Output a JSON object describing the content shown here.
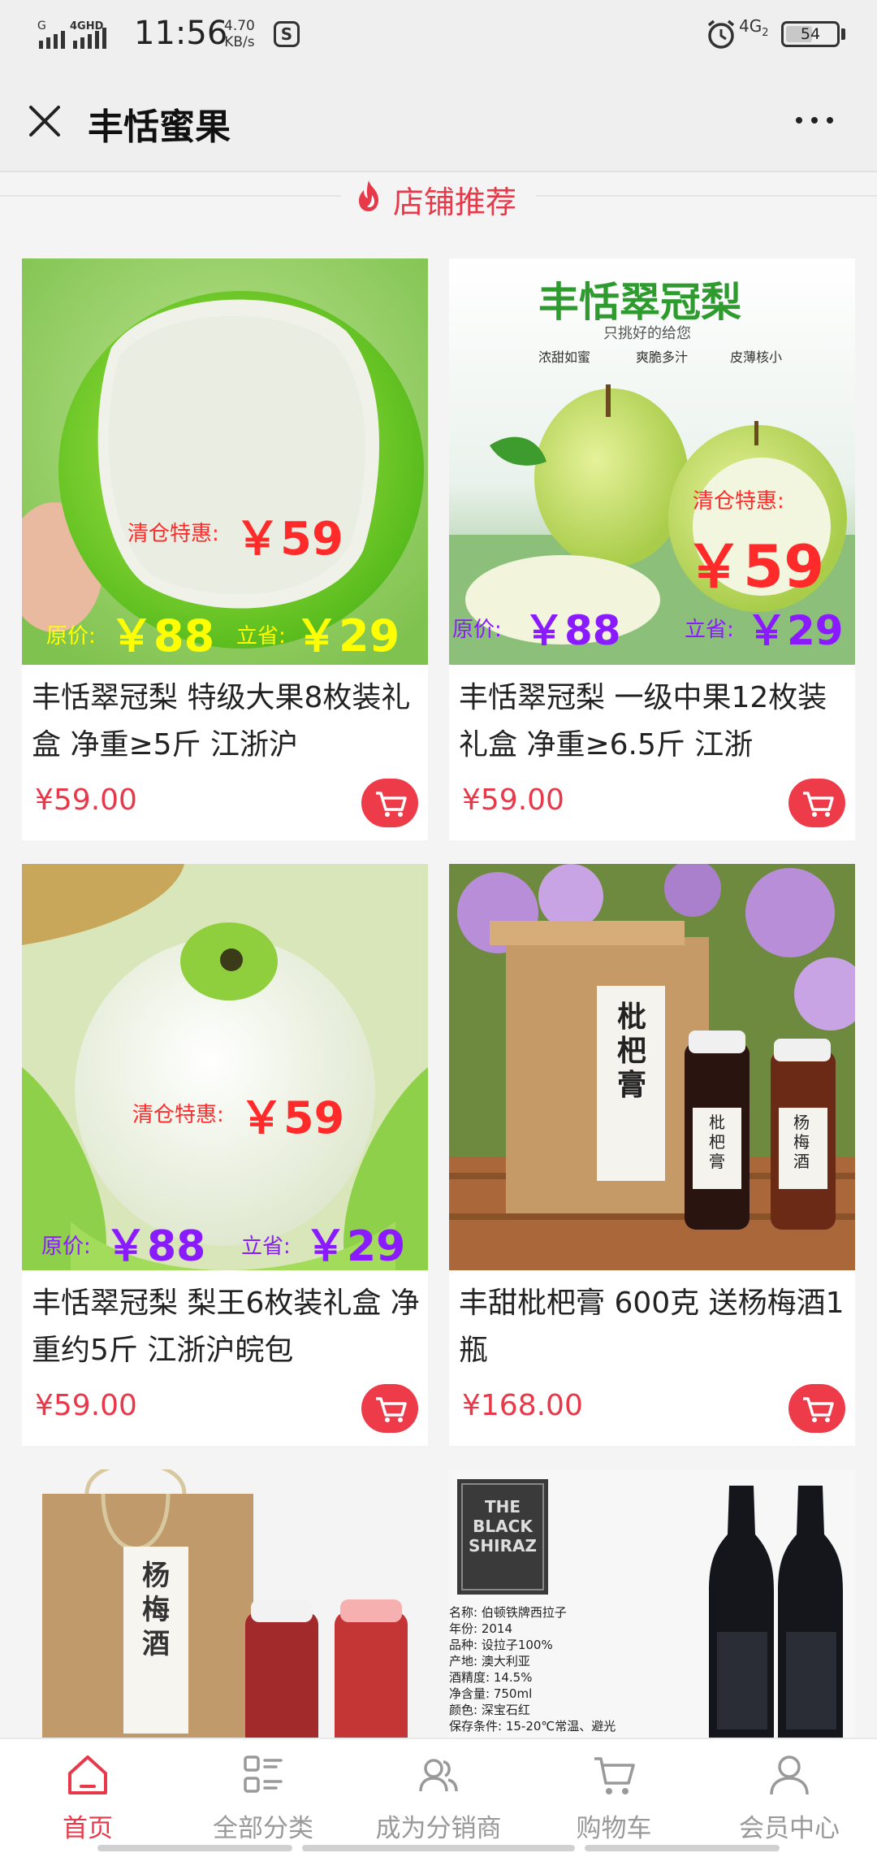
{
  "status_bar": {
    "signal_1": "G",
    "signal_2": "4GHD",
    "time": "11:56",
    "speed_value": "4.70",
    "speed_unit": "KB/s",
    "app_icon": "S",
    "network": "4G",
    "network_sub": "2",
    "battery": "54",
    "battery_level_percent": 54
  },
  "title_bar": {
    "title": "丰恬蜜果",
    "close_icon": "close-icon",
    "more_icon": "more-dots-icon"
  },
  "section": {
    "label": "店铺推荐",
    "icon": "fire-icon"
  },
  "products": [
    {
      "title": "丰恬翠冠梨 特级大果8枚装礼盒 净重≥5斤 江浙沪",
      "price": "¥59.00",
      "overlay": {
        "clearance_label": "清仓特惠:",
        "clearance_price": "￥59",
        "original_label": "原价:",
        "original_price": "￥88",
        "save_label": "立省:",
        "save_price": "￥29"
      }
    },
    {
      "title": "丰恬翠冠梨 一级中果12枚装礼盒 净重≥6.5斤 江浙",
      "price": "¥59.00",
      "overlay": {
        "brand_title": "丰恬翠冠梨",
        "brand_sub": "只挑好的给您",
        "feature_1": "浓甜如蜜",
        "feature_2": "爽脆多汁",
        "feature_3": "皮薄核小",
        "clearance_label": "清仓特惠:",
        "clearance_price": "￥59",
        "original_label": "原价:",
        "original_price": "￥88",
        "save_label": "立省:",
        "save_price": "￥29"
      }
    },
    {
      "title": "丰恬翠冠梨 梨王6枚装礼盒 净重约5斤 江浙沪皖包",
      "price": "¥59.00",
      "overlay": {
        "clearance_label": "清仓特惠:",
        "clearance_price": "￥59",
        "original_label": "原价:",
        "original_price": "￥88",
        "save_label": "立省:",
        "save_price": "￥29"
      }
    },
    {
      "title": "丰甜枇杷膏 600克 送杨梅酒1瓶",
      "price": "¥168.00",
      "overlay": {
        "box_label": "枇杷膏",
        "jar_1": "枇杷膏",
        "jar_2": "杨梅酒"
      }
    },
    {
      "title": "",
      "price": "",
      "overlay": {
        "bag_label": "杨梅酒"
      }
    },
    {
      "title": "",
      "price": "",
      "overlay": {
        "wine_brand": "THE BLACK SHIRAZ",
        "spec_1": "名称: 伯顿铁牌西拉子",
        "spec_2": "年份: 2014",
        "spec_3": "品种: 设拉子100%",
        "spec_4": "产地: 澳大利亚",
        "spec_5": "酒精度: 14.5%",
        "spec_6": "净含量: 750ml",
        "spec_7": "颜色: 深宝石红",
        "spec_8": "保存条件: 15-20℃常温、避光"
      }
    }
  ],
  "bottom_nav": [
    {
      "label": "首页",
      "icon": "home-icon",
      "active": true
    },
    {
      "label": "全部分类",
      "icon": "category-icon",
      "active": false
    },
    {
      "label": "成为分销商",
      "icon": "distributor-icon",
      "active": false
    },
    {
      "label": "购物车",
      "icon": "cart-icon",
      "active": false
    },
    {
      "label": "会员中心",
      "icon": "user-icon",
      "active": false
    }
  ],
  "colors": {
    "accent": "#e8394a",
    "price_red": "#e8394a",
    "overlay_red": "#ff2b2b",
    "overlay_yellow": "#ffff00",
    "overlay_purple": "#8a1bff",
    "nav_inactive": "#999999"
  }
}
